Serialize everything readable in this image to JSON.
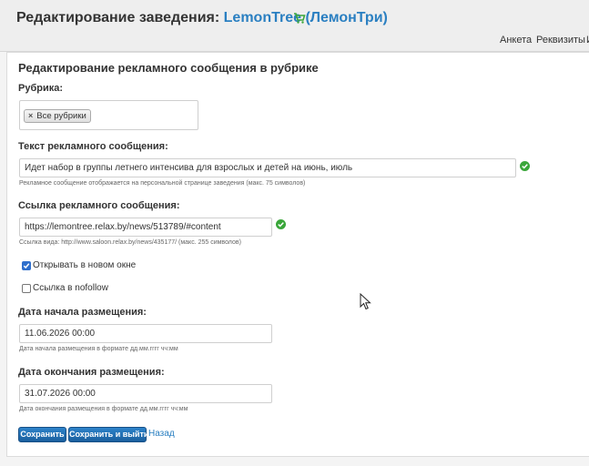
{
  "header": {
    "title_prefix": "Редактирование заведения:",
    "venue_name": "LemonTree (ЛемонТри)",
    "cart_icon": "cart-icon",
    "nav": [
      "Анкета",
      "Реквизиты",
      "И"
    ]
  },
  "form": {
    "heading": "Редактирование рекламного сообщения в рубрике",
    "rubric": {
      "label": "Рубрика:",
      "tag_remove": "×",
      "tag": "Все рубрики"
    },
    "text": {
      "label": "Текст рекламного сообщения:",
      "value": "Идет набор в группы летнего интенсива для взрослых и детей на июнь, июль",
      "hint": "Рекламное сообщение отображается на персональной странице заведения (макс. 75 символов)"
    },
    "link": {
      "label": "Ссылка рекламного сообщения:",
      "value": "https://lemontree.relax.by/news/513789/#content",
      "hint": "Ссылка вида: http://www.saloon.relax.by/news/435177/ (макс. 255 символов)"
    },
    "new_window": {
      "label": "Открывать в новом окне",
      "checked": true
    },
    "nofollow": {
      "label": "Ссылка в nofollow",
      "checked": false
    },
    "start": {
      "label": "Дата начала размещения:",
      "value": "11.06.2026 00:00",
      "hint": "Дата начала размещения в формате дд.мм.гггг чч:мм"
    },
    "end": {
      "label": "Дата окончания размещения:",
      "value": "31.07.2026 00:00",
      "hint": "Дата окончания размещения в формате дд.мм.гггг чч:мм"
    },
    "buttons": {
      "save": "Сохранить",
      "save_exit": "Сохранить и выйти",
      "back": "Назад"
    }
  },
  "colors": {
    "accent": "#2a7fc1",
    "button": "#1f6db0",
    "valid": "#3aa63a"
  }
}
